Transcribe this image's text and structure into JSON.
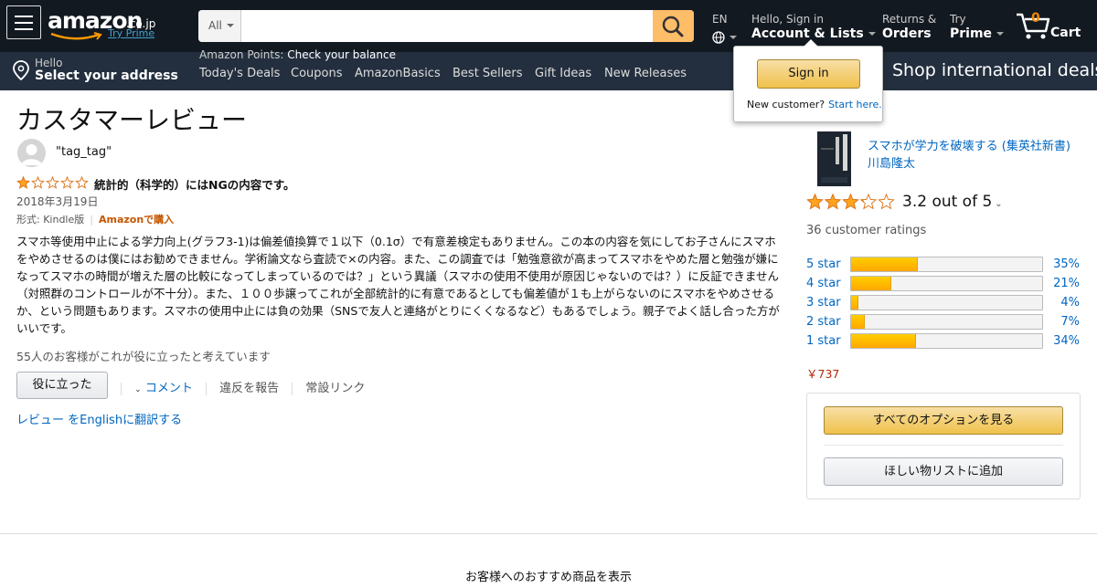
{
  "header": {
    "logo": {
      "word": "amazon",
      "tld": ".co.jp",
      "prime_link": "Try Prime"
    },
    "search": {
      "category": "All",
      "value": "",
      "placeholder": ""
    },
    "language": {
      "code": "EN"
    },
    "account": {
      "line1": "Hello, Sign in",
      "line2": "Account & Lists"
    },
    "returns": {
      "line1": "Returns &",
      "line2": "Orders"
    },
    "prime": {
      "line1": "Try",
      "line2": "Prime"
    },
    "cart": {
      "count": "0",
      "label": "Cart"
    },
    "points": {
      "label": "Amazon Points",
      "link": "Check your balance"
    },
    "address": {
      "line1": "Hello",
      "line2": "Select your address"
    },
    "subnav": [
      "Today's Deals",
      "Coupons",
      "AmazonBasics",
      "Best Sellers",
      "Gift Ideas",
      "New Releases"
    ],
    "promo": "Shop international deals",
    "colors": {
      "nav_top": "#131921",
      "nav_sub": "#232f3e",
      "accent": "#febd69",
      "cart_count": "#f08804"
    }
  },
  "signin_flyout": {
    "button": "Sign in",
    "new_customer": "New customer?",
    "start_here": "Start here."
  },
  "review": {
    "page_title": "カスタマーレビュー",
    "reviewer": "\"tag_tag\"",
    "rating": 1,
    "title": "統計的（科学的）にはNGの内容です。",
    "date": "2018年3月19日",
    "format": "形式: Kindle版",
    "verified": "Amazonで購入",
    "body": "スマホ等使用中止による学力向上(グラフ3-1)は偏差値換算で１以下（0.1σ）で有意差検定もありません。この本の内容を気にしてお子さんにスマホをやめさせるのは僕にはお勧めできません。学術論文なら査読で×の内容。また、この調査では「勉強意欲が高まってスマホをやめた層と勉強が嫌になってスマホの時間が増えた層の比較になってしまっているのでは？」という異議（スマホの使用不使用が原因じゃないのでは？）に反証できません（対照群のコントロールが不十分）。また、１００歩譲ってこれが全部統計的に有意であるとしても偏差値が１も上がらないのにスマホをやめさせるか、という問題もあります。スマホの使用中止には負の効果（SNSで友人と連絡がとりにくくなるなど）もあるでしょう。親子でよく話し合った方がいいです。",
    "helpful_count": "55人のお客様がこれが役に立ったと考えています",
    "helpful_button": "役に立った",
    "comment": "コメント",
    "report": "違反を報告",
    "permalink": "常設リンク",
    "translate": "レビュー をEnglishに翻訳する"
  },
  "product": {
    "title_line1": "スマホが学力を破壊する (集英社新書)",
    "author": "川島隆太",
    "average_rating": 3.2,
    "rating_text": "3.2 out of 5",
    "ratings_count": "36 customer ratings",
    "histogram": [
      {
        "label": "5 star",
        "pct": 35,
        "pct_text": "35%"
      },
      {
        "label": "4 star",
        "pct": 21,
        "pct_text": "21%"
      },
      {
        "label": "3 star",
        "pct": 4,
        "pct_text": "4%"
      },
      {
        "label": "2 star",
        "pct": 7,
        "pct_text": "7%"
      },
      {
        "label": "1 star",
        "pct": 34,
        "pct_text": "34%"
      }
    ],
    "price": "￥737",
    "options_button": "すべてのオプションを見る",
    "wishlist_button": "ほしい物リストに追加"
  },
  "recommendations": {
    "title": "お客様へのおすすめ商品を表示"
  }
}
